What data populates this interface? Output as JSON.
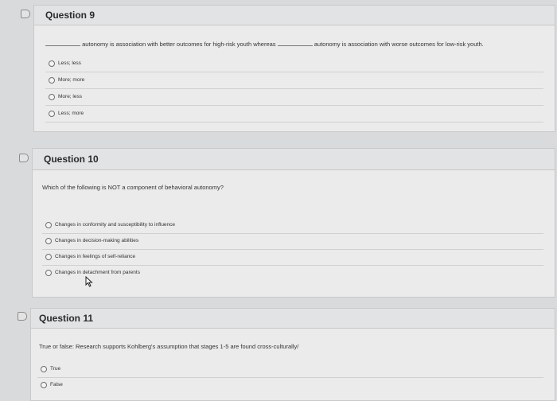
{
  "questions": [
    {
      "title": "Question 9",
      "prompt_part1": "autonomy is association with better outcomes for high-risk youth whereas",
      "prompt_part2": "autonomy is association with worse outcomes for low-risk youth.",
      "options": [
        "Less; less",
        "More; more",
        "More; less",
        "Less; more"
      ]
    },
    {
      "title": "Question 10",
      "prompt": "Which of the following is NOT a component of behavioral autonomy?",
      "options": [
        "Changes in conformity and susceptibility to influence",
        "Changes in decision-making abilities",
        "Changes in feelings of self-reliance",
        "Changes in detachment from parents"
      ]
    },
    {
      "title": "Question 11",
      "prompt": "True or false: Research supports Kohlberg's assumption that stages 1-5 are found cross-culturally/",
      "options": [
        "True",
        "False"
      ]
    }
  ],
  "colors": {
    "background": "#d9dadc",
    "card": "#ebebec",
    "header": "#e2e3e5",
    "flag": "#8c8c8c"
  },
  "icons": [
    "flag-icon",
    "radio-icon",
    "mouse-cursor-icon"
  ]
}
